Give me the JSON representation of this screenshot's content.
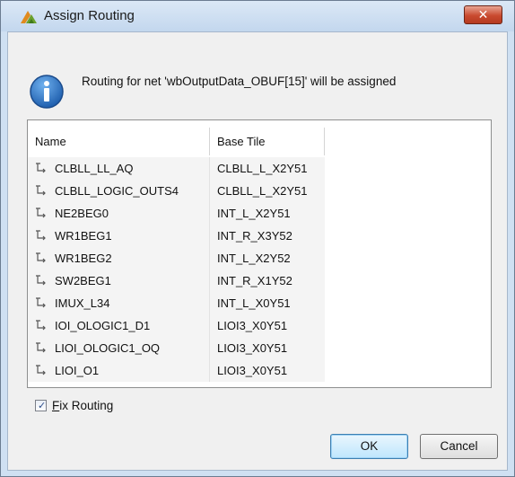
{
  "window": {
    "title": "Assign Routing",
    "close_label": "✕"
  },
  "message": "Routing for net 'wbOutputData_OBUF[15]' will be assigned",
  "table": {
    "columns": [
      "Name",
      "Base Tile"
    ],
    "rows": [
      {
        "name": "CLBLL_LL_AQ",
        "tile": "CLBLL_L_X2Y51"
      },
      {
        "name": "CLBLL_LOGIC_OUTS4",
        "tile": "CLBLL_L_X2Y51"
      },
      {
        "name": "NE2BEG0",
        "tile": "INT_L_X2Y51"
      },
      {
        "name": "WR1BEG1",
        "tile": "INT_R_X3Y52"
      },
      {
        "name": "WR1BEG2",
        "tile": "INT_L_X2Y52"
      },
      {
        "name": "SW2BEG1",
        "tile": "INT_R_X1Y52"
      },
      {
        "name": "IMUX_L34",
        "tile": "INT_L_X0Y51"
      },
      {
        "name": "IOI_OLOGIC1_D1",
        "tile": "LIOI3_X0Y51"
      },
      {
        "name": "LIOI_OLOGIC1_OQ",
        "tile": "LIOI3_X0Y51"
      },
      {
        "name": "LIOI_O1",
        "tile": "LIOI3_X0Y51"
      }
    ]
  },
  "fix_routing": {
    "label_first": "F",
    "label_rest": "ix Routing",
    "checked": true
  },
  "buttons": {
    "ok": "OK",
    "cancel": "Cancel"
  },
  "icons": {
    "app": "vivado-logo-icon",
    "info": "info-icon",
    "node": "routing-node-icon"
  },
  "colors": {
    "info_blue": "#1f5fae",
    "logo_green": "#6aa02d",
    "logo_orange": "#e08a1e"
  }
}
